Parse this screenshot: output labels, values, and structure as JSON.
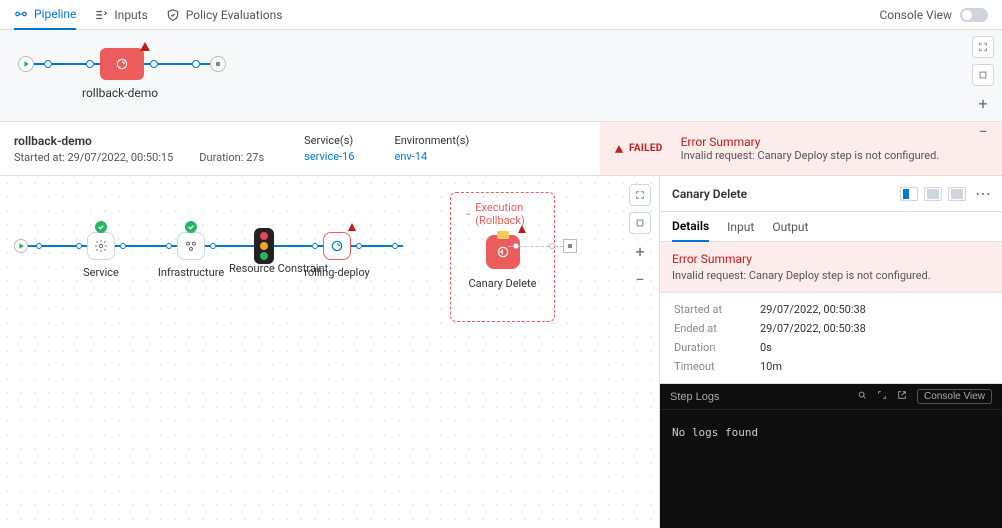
{
  "topbar": {
    "tabs": [
      {
        "label": "Pipeline"
      },
      {
        "label": "Inputs"
      },
      {
        "label": "Policy Evaluations"
      }
    ],
    "console_view": "Console View"
  },
  "overview": {
    "stage_label": "rollback-demo"
  },
  "summary": {
    "name": "rollback-demo",
    "start_line": "Started at: 29/07/2022, 00:50:15",
    "duration_line": "Duration: 27s",
    "services_label": "Service(s)",
    "service_link": "service-16",
    "envs_label": "Environment(s)",
    "env_link": "env-14",
    "status": "FAILED",
    "err_title": "Error Summary",
    "err_msg": "Invalid request: Canary Deploy step is not configured."
  },
  "canvas": {
    "nodes": {
      "service": "Service",
      "infra": "Infrastructure",
      "rc": "Resource Constraint",
      "rd": "rolling-deploy",
      "cd": "Canary Delete",
      "sub_title": "Execution (Rollback)"
    }
  },
  "details": {
    "title": "Canary Delete",
    "tabs": {
      "details": "Details",
      "input": "Input",
      "output": "Output"
    },
    "err_title": "Error Summary",
    "err_msg": "Invalid request: Canary Deploy step is not configured.",
    "meta": {
      "started_k": "Started at",
      "started_v": "29/07/2022, 00:50:38",
      "ended_k": "Ended at",
      "ended_v": "29/07/2022, 00:50:38",
      "dur_k": "Duration",
      "dur_v": "0s",
      "to_k": "Timeout",
      "to_v": "10m"
    },
    "logs": {
      "title": "Step Logs",
      "console_view": "Console View",
      "no_logs": "No logs found"
    }
  }
}
